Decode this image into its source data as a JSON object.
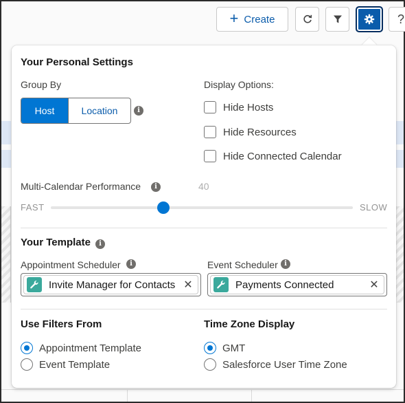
{
  "toolbar": {
    "create_label": "Create",
    "help_glyph": "?"
  },
  "settings": {
    "title": "Your Personal Settings",
    "group_by": {
      "label": "Group By",
      "options": [
        "Host",
        "Location"
      ],
      "selected": "Host"
    },
    "display_options": {
      "label": "Display Options:",
      "items": [
        {
          "label": "Hide Hosts",
          "checked": false
        },
        {
          "label": "Hide Resources",
          "checked": false
        },
        {
          "label": "Hide Connected Calendar",
          "checked": false
        }
      ]
    },
    "performance": {
      "label": "Multi-Calendar Performance",
      "value": "40",
      "min_label": "FAST",
      "max_label": "SLOW",
      "level_fraction": 0.37
    }
  },
  "template": {
    "title": "Your Template",
    "appointment_scheduler": {
      "label": "Appointment Scheduler",
      "value": "Invite Manager for Contacts"
    },
    "event_scheduler": {
      "label": "Event Scheduler",
      "value": "Payments Connected"
    }
  },
  "filters": {
    "title": "Use Filters From",
    "options": [
      "Appointment Template",
      "Event Template"
    ],
    "selected": "Appointment Template"
  },
  "timezone": {
    "title": "Time Zone Display",
    "options": [
      "GMT",
      "Salesforce User Time Zone"
    ],
    "selected": "GMT"
  },
  "colors": {
    "brand": "#0176d3",
    "pill_icon": "#3ba99c"
  }
}
